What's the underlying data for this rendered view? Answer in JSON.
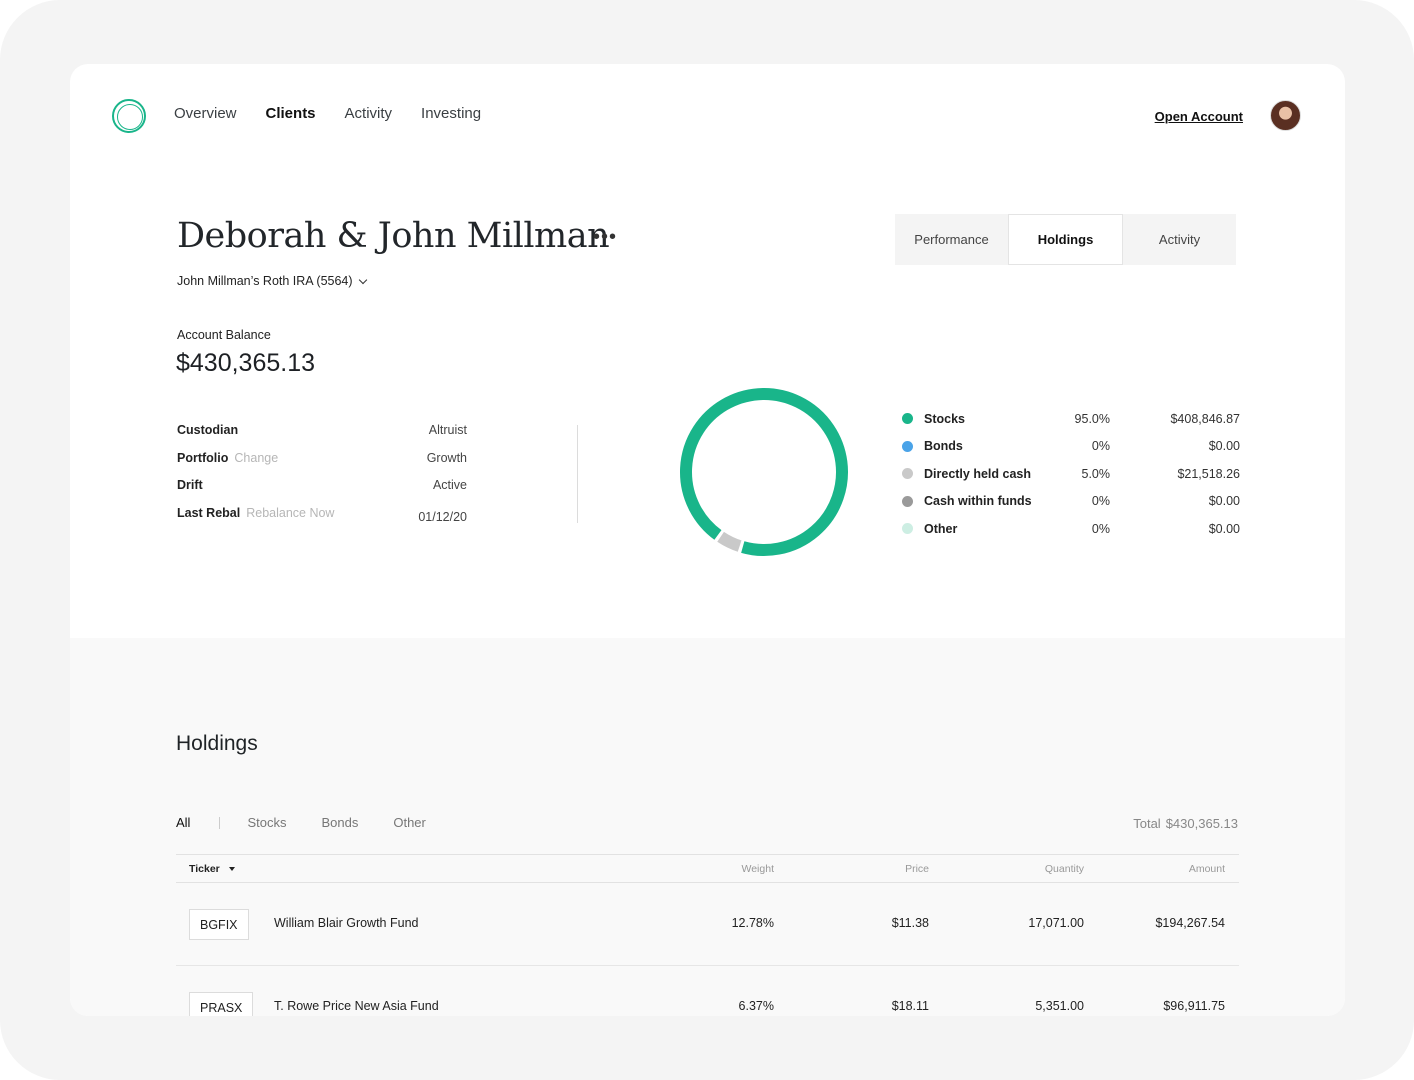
{
  "nav": {
    "items": [
      "Overview",
      "Clients",
      "Activity",
      "Investing"
    ],
    "open_account": "Open Account"
  },
  "client": {
    "name": "Deborah & John Millman",
    "account": "John Millman’s Roth IRA (5564)"
  },
  "tabs": [
    "Performance",
    "Holdings",
    "Activity"
  ],
  "balance": {
    "label": "Account Balance",
    "value": "$430,365.13"
  },
  "details": {
    "custodian": {
      "label": "Custodian",
      "value": "Altruist"
    },
    "portfolio": {
      "label": "Portfolio",
      "link": "Change",
      "value": "Growth"
    },
    "drift": {
      "label": "Drift",
      "value": "Active"
    },
    "last_rebal": {
      "label": "Last Rebal",
      "link": "Rebalance Now",
      "value": "01/12/20"
    }
  },
  "chart_data": {
    "type": "pie",
    "categories": [
      "Stocks",
      "Bonds",
      "Directly held cash",
      "Cash within funds",
      "Other"
    ],
    "values": [
      95.0,
      0,
      5.0,
      0,
      0
    ],
    "colors": [
      "#19b58a",
      "#4aa3e8",
      "#c9c9c9",
      "#9a9a9a",
      "#cdeee3"
    ]
  },
  "allocation": [
    {
      "name": "Stocks",
      "pct": "95.0%",
      "amount": "$408,846.87",
      "color": "#19b58a"
    },
    {
      "name": "Bonds",
      "pct": "0%",
      "amount": "$0.00",
      "color": "#4aa3e8"
    },
    {
      "name": "Directly held cash",
      "pct": "5.0%",
      "amount": "$21,518.26",
      "color": "#c9c9c9"
    },
    {
      "name": "Cash within funds",
      "pct": "0%",
      "amount": "$0.00",
      "color": "#9a9a9a"
    },
    {
      "name": "Other",
      "pct": "0%",
      "amount": "$0.00",
      "color": "#cdeee3"
    }
  ],
  "holdings": {
    "title": "Holdings",
    "filters": [
      "All",
      "Stocks",
      "Bonds",
      "Other"
    ],
    "total_label": "Total",
    "total_value": "$430,365.13",
    "columns": [
      "Ticker",
      "Weight",
      "Price",
      "Quantity",
      "Amount"
    ],
    "rows": [
      {
        "ticker": "BGFIX",
        "name": "William Blair Growth Fund",
        "weight": "12.78%",
        "price": "$11.38",
        "quantity": "17,071.00",
        "amount": "$194,267.54"
      },
      {
        "ticker": "PRASX",
        "name": "T. Rowe Price New Asia Fund",
        "weight": "6.37%",
        "price": "$18.11",
        "quantity": "5,351.00",
        "amount": "$96,911.75"
      }
    ]
  }
}
